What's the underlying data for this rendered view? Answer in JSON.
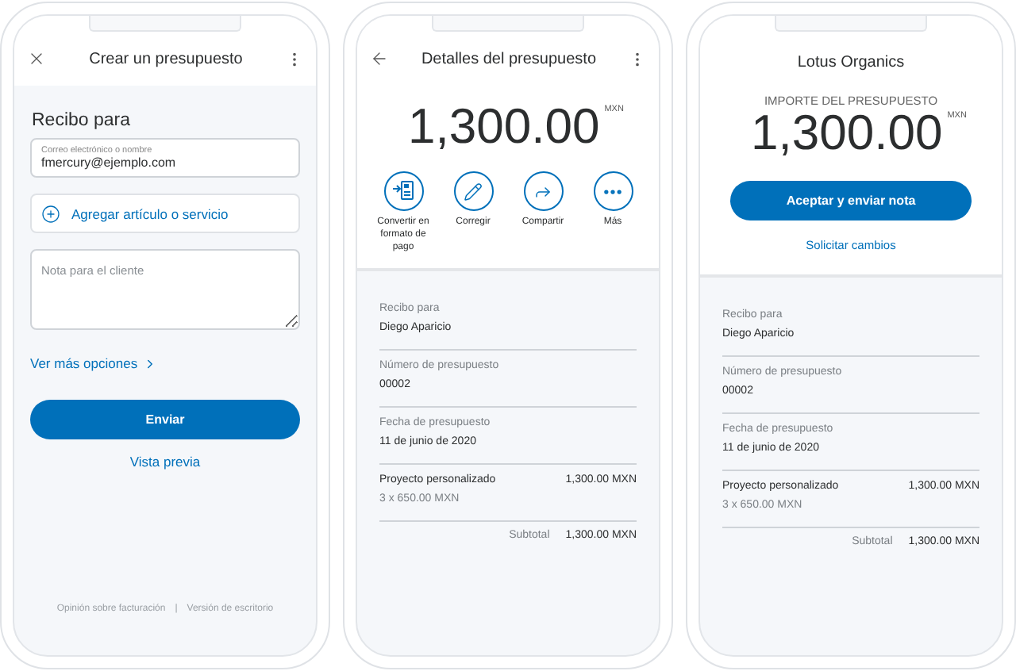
{
  "create_screen": {
    "title": "Crear un presupuesto",
    "section_title": "Recibo para",
    "recipient_field": {
      "label": "Correo electrónico o nombre",
      "value": "fmercury@ejemplo.com"
    },
    "add_item": "Agregar artículo o servicio",
    "note_field": {
      "placeholder": "Nota para el cliente"
    },
    "more_options": "Ver más opciones",
    "send_button": "Enviar",
    "preview_link": "Vista previa",
    "footer_links": [
      "Opinión sobre facturación",
      "Versión de escritorio"
    ],
    "footer_separator": "|"
  },
  "details_screen": {
    "title": "Detalles del presupuesto",
    "amount": "1,300.00",
    "currency": "MXN",
    "actions": [
      {
        "kind": "convert",
        "label": "Convertir en formato de pago"
      },
      {
        "kind": "edit",
        "label": "Corregir"
      },
      {
        "kind": "share",
        "label": "Compartir"
      },
      {
        "kind": "more",
        "label": "Más"
      }
    ],
    "fields": [
      {
        "label": "Recibo para",
        "value": "Diego Aparicio"
      },
      {
        "label": "Número de presupuesto",
        "value": "00002"
      },
      {
        "label": "Fecha de presupuesto",
        "value": "11 de junio de 2020"
      }
    ],
    "item": {
      "name": "Proyecto personalizado",
      "quantity": "3 x 650.00 MXN",
      "amount": "1,300.00 MXN"
    },
    "subtotal": {
      "label": "Subtotal",
      "value": "1,300.00 MXN"
    }
  },
  "review_screen": {
    "merchant": "Lotus Organics",
    "amount_label": "IMPORTE DEL PRESUPUESTO",
    "amount": "1,300.00",
    "currency": "MXN",
    "accept_button": "Aceptar y enviar nota",
    "request_changes_link": "Solicitar cambios",
    "fields": [
      {
        "label": "Recibo para",
        "value": "Diego Aparicio"
      },
      {
        "label": "Número de presupuesto",
        "value": "00002"
      },
      {
        "label": "Fecha de presupuesto",
        "value": "11 de junio de 2020"
      }
    ],
    "item": {
      "name": "Proyecto personalizado",
      "quantity": "3 x 650.00 MXN",
      "amount": "1,300.00 MXN"
    },
    "subtotal": {
      "label": "Subtotal",
      "value": "1,300.00 MXN"
    }
  }
}
